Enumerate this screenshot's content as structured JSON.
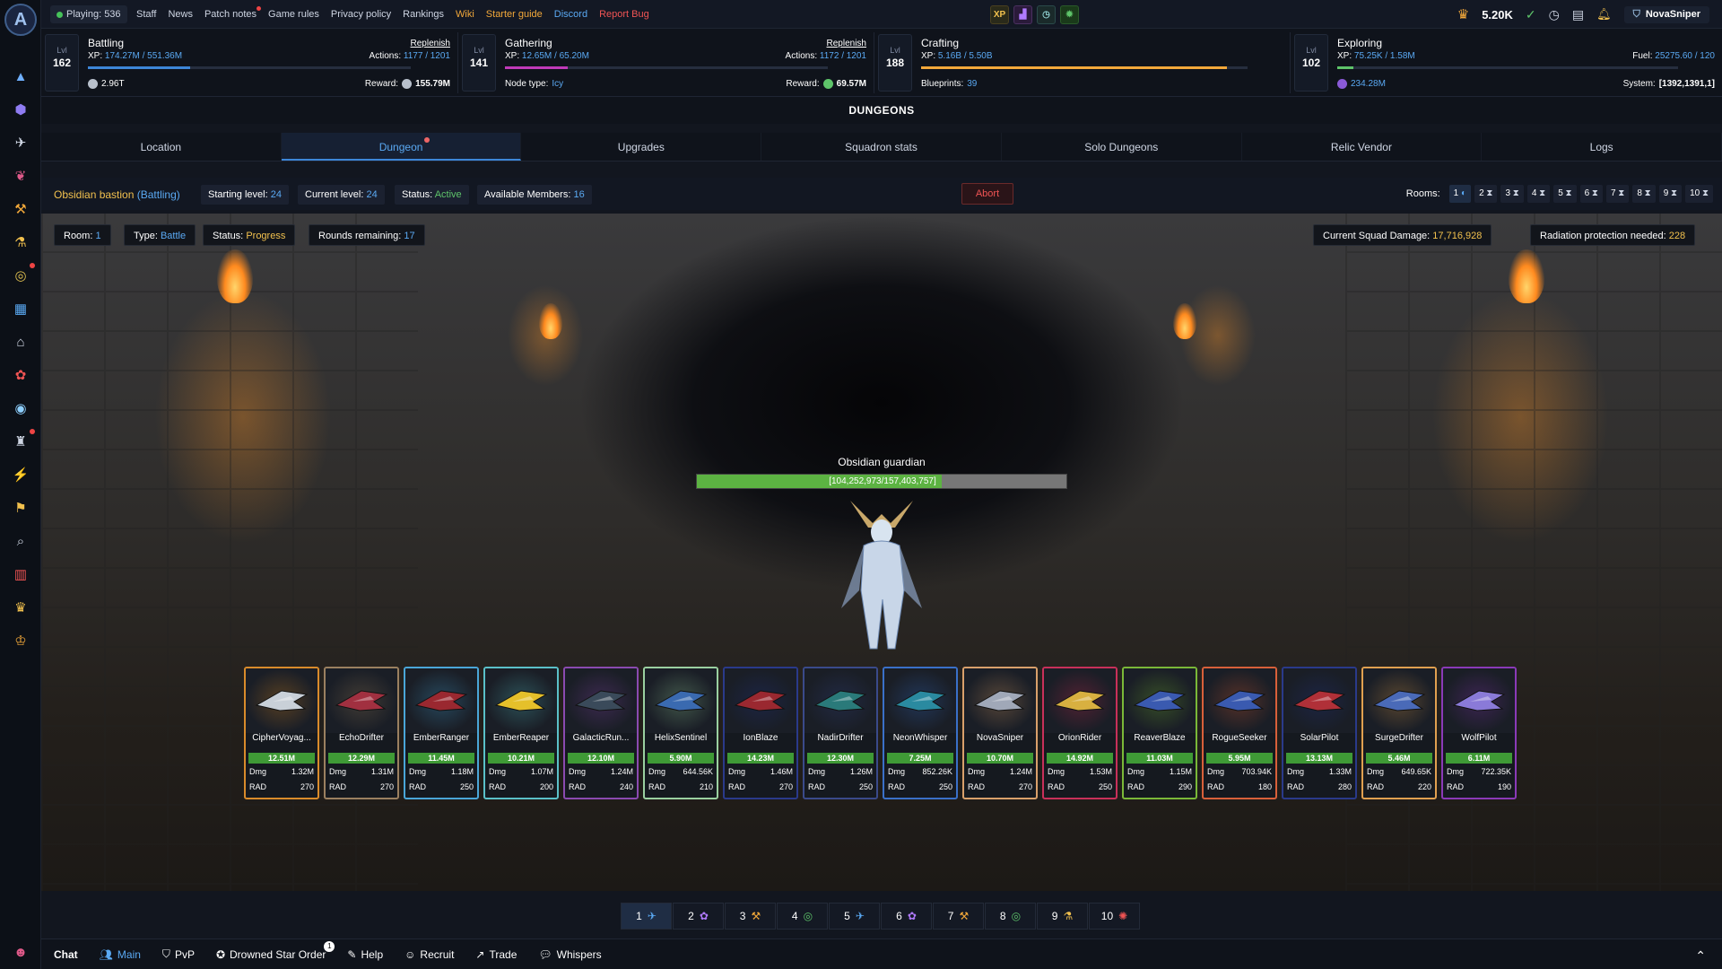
{
  "topbar": {
    "playing": "Playing: 536",
    "links": [
      "Staff",
      "News",
      "Patch notes",
      "Game rules",
      "Privacy policy",
      "Rankings",
      "Wiki",
      "Starter guide",
      "Discord",
      "Report Bug"
    ],
    "link_colors": [
      "#cfd6e4",
      "#cfd6e4",
      "#cfd6e4",
      "#cfd6e4",
      "#cfd6e4",
      "#cfd6e4",
      "#f2a83a",
      "#f2a83a",
      "#5aa9f3",
      "#f05454"
    ],
    "xp_icon": "XP",
    "gold": "5.20K",
    "username": "NovaSniper"
  },
  "skills": {
    "battling": {
      "lvl_label": "Lvl",
      "lvl": "162",
      "name": "Battling",
      "xp_label": "XP:",
      "xp": "174.27M / 551.36M",
      "link": "Replenish",
      "actions_label": "Actions:",
      "actions": "1177 / 1201",
      "progress": 0.316,
      "left_value": "2.96T",
      "reward_label": "Reward:",
      "reward": "155.79M"
    },
    "gathering": {
      "lvl_label": "Lvl",
      "lvl": "141",
      "name": "Gathering",
      "xp_label": "XP:",
      "xp": "12.65M / 65.20M",
      "link": "Replenish",
      "actions_label": "Actions:",
      "actions": "1172 / 1201",
      "progress": 0.194,
      "node_label": "Node type:",
      "node": "Icy",
      "reward_label": "Reward:",
      "reward": "69.57M"
    },
    "crafting": {
      "lvl_label": "Lvl",
      "lvl": "188",
      "name": "Crafting",
      "xp_label": "XP:",
      "xp": "5.16B / 5.50B",
      "progress": 0.938,
      "bp_label": "Blueprints:",
      "bp": "39"
    },
    "exploring": {
      "lvl_label": "Lvl",
      "lvl": "102",
      "name": "Exploring",
      "xp_label": "XP:",
      "xp": "75.25K / 1.58M",
      "fuel_label": "Fuel:",
      "fuel": "25275.60 / 120",
      "progress": 0.048,
      "left_value": "234.28M",
      "system_label": "System:",
      "system": "[1392,1391,1]"
    }
  },
  "section_title": "DUNGEONS",
  "tabs": [
    "Location",
    "Dungeon",
    "Upgrades",
    "Squadron stats",
    "Solo Dungeons",
    "Relic Vendor",
    "Logs"
  ],
  "info": {
    "dungeon_name": "Obsidian bastion",
    "dungeon_type": "(Battling)",
    "starting_label": "Starting level:",
    "starting": "24",
    "current_label": "Current level:",
    "current": "24",
    "status_label": "Status:",
    "status": "Active",
    "members_label": "Available Members:",
    "members": "16",
    "abort": "Abort",
    "rooms_label": "Rooms:",
    "rooms": [
      "1",
      "2",
      "3",
      "4",
      "5",
      "6",
      "7",
      "8",
      "9",
      "10"
    ]
  },
  "room": {
    "room_label": "Room:",
    "room": "1",
    "type_label": "Type:",
    "type": "Battle",
    "status_label": "Status:",
    "status": "Progress",
    "rounds_label": "Rounds remaining:",
    "rounds": "17",
    "damage_label": "Current Squad Damage:",
    "damage": "17,716,928",
    "rad_label": "Radiation protection needed:",
    "rad": "228"
  },
  "boss": {
    "name": "Obsidian guardian",
    "hp_text": "[104,252,973/157,403,757]",
    "hp_fraction": 0.662
  },
  "cards": [
    {
      "name": "CipherVoyag...",
      "hp": "12.51M",
      "dmg_label": "Dmg",
      "dmg": "1.32M",
      "rad_label": "RAD",
      "rad": "270",
      "border": "#d98b2b",
      "color": "#c9d0d8"
    },
    {
      "name": "EchoDrifter",
      "hp": "12.29M",
      "dmg_label": "Dmg",
      "dmg": "1.31M",
      "rad_label": "RAD",
      "rad": "270",
      "border": "#9a8060",
      "color": "#a13040"
    },
    {
      "name": "EmberRanger",
      "hp": "11.45M",
      "dmg_label": "Dmg",
      "dmg": "1.18M",
      "rad_label": "RAD",
      "rad": "250",
      "border": "#4aa6d8",
      "color": "#9a2830"
    },
    {
      "name": "EmberReaper",
      "hp": "10.21M",
      "dmg_label": "Dmg",
      "dmg": "1.07M",
      "rad_label": "RAD",
      "rad": "200",
      "border": "#5ac0c8",
      "color": "#e5c02a"
    },
    {
      "name": "GalacticRun...",
      "hp": "12.10M",
      "dmg_label": "Dmg",
      "dmg": "1.24M",
      "rad_label": "RAD",
      "rad": "240",
      "border": "#8a4ab0",
      "color": "#3a4a5a"
    },
    {
      "name": "HelixSentinel",
      "hp": "5.90M",
      "dmg_label": "Dmg",
      "dmg": "644.56K",
      "rad_label": "RAD",
      "rad": "210",
      "border": "#9ad0a0",
      "color": "#3a6ab0"
    },
    {
      "name": "IonBlaze",
      "hp": "14.23M",
      "dmg_label": "Dmg",
      "dmg": "1.46M",
      "rad_label": "RAD",
      "rad": "270",
      "border": "#2a3a8a",
      "color": "#9a2830"
    },
    {
      "name": "NadirDrifter",
      "hp": "12.30M",
      "dmg_label": "Dmg",
      "dmg": "1.26M",
      "rad_label": "RAD",
      "rad": "250",
      "border": "#3a4a8a",
      "color": "#2a7a7a"
    },
    {
      "name": "NeonWhisper",
      "hp": "7.25M",
      "dmg_label": "Dmg",
      "dmg": "852.26K",
      "rad_label": "RAD",
      "rad": "250",
      "border": "#3a70c8",
      "color": "#2a8aa0"
    },
    {
      "name": "NovaSniper",
      "hp": "10.70M",
      "dmg_label": "Dmg",
      "dmg": "1.24M",
      "rad_label": "RAD",
      "rad": "270",
      "border": "#d9a06b",
      "color": "#a0a8b8"
    },
    {
      "name": "OrionRider",
      "hp": "14.92M",
      "dmg_label": "Dmg",
      "dmg": "1.53M",
      "rad_label": "RAD",
      "rad": "250",
      "border": "#c8305a",
      "color": "#d8b040"
    },
    {
      "name": "ReaverBlaze",
      "hp": "11.03M",
      "dmg_label": "Dmg",
      "dmg": "1.15M",
      "rad_label": "RAD",
      "rad": "290",
      "border": "#7ab838",
      "color": "#3a5ab0"
    },
    {
      "name": "RogueSeeker",
      "hp": "5.95M",
      "dmg_label": "Dmg",
      "dmg": "703.94K",
      "rad_label": "RAD",
      "rad": "180",
      "border": "#d8603a",
      "color": "#3a5ab0"
    },
    {
      "name": "SolarPilot",
      "hp": "13.13M",
      "dmg_label": "Dmg",
      "dmg": "1.33M",
      "rad_label": "RAD",
      "rad": "280",
      "border": "#2a3a8a",
      "color": "#b03038"
    },
    {
      "name": "SurgeDrifter",
      "hp": "5.46M",
      "dmg_label": "Dmg",
      "dmg": "649.65K",
      "rad_label": "RAD",
      "rad": "220",
      "border": "#e0a050",
      "color": "#4a6ab8"
    },
    {
      "name": "WolfPilot",
      "hp": "6.11M",
      "dmg_label": "Dmg",
      "dmg": "722.35K",
      "rad_label": "RAD",
      "rad": "190",
      "border": "#8a3ab8",
      "color": "#8a7ad8"
    }
  ],
  "hotbar": [
    {
      "num": "1",
      "icon": "rocket-icon"
    },
    {
      "num": "2",
      "icon": "paw-icon"
    },
    {
      "num": "3",
      "icon": "pickaxe-icon"
    },
    {
      "num": "4",
      "icon": "target-icon"
    },
    {
      "num": "5",
      "icon": "rocket-icon"
    },
    {
      "num": "6",
      "icon": "paw-icon"
    },
    {
      "num": "7",
      "icon": "pickaxe-icon"
    },
    {
      "num": "8",
      "icon": "target-icon"
    },
    {
      "num": "9",
      "icon": "flask-icon"
    },
    {
      "num": "10",
      "icon": "bug-icon"
    }
  ],
  "chat": {
    "title": "Chat",
    "tabs": [
      "Main",
      "PvP",
      "Drowned Star Order",
      "Help",
      "Recruit",
      "Trade",
      "Whispers"
    ],
    "badge": "1"
  },
  "colors": {
    "accent": "#5aa9f3",
    "active_green": "#5ec46a",
    "progress_yellow": "#f2c14e",
    "danger": "#f05454",
    "hp_green": "#5cb342"
  }
}
